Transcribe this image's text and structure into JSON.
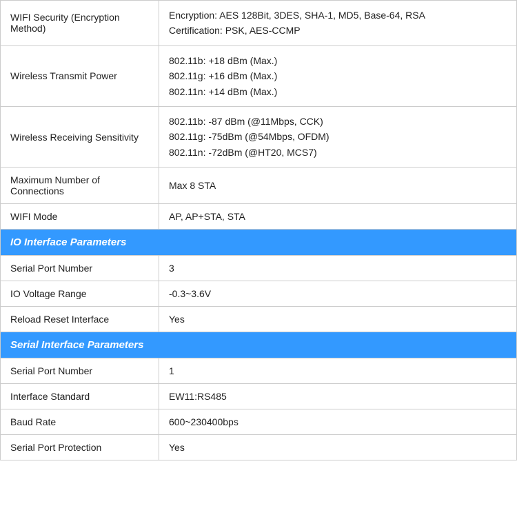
{
  "rows": [
    {
      "type": "data",
      "label": "WIFI Security (Encryption Method)",
      "value": "Encryption: AES 128Bit, 3DES, SHA-1, MD5, Base-64, RSA\nCertification: PSK, AES-CCMP"
    },
    {
      "type": "data",
      "label": "Wireless Transmit Power",
      "value": "802.11b: +18 dBm (Max.)\n802.11g: +16 dBm (Max.)\n802.11n: +14 dBm (Max.)"
    },
    {
      "type": "data",
      "label": "Wireless Receiving Sensitivity",
      "value": "802.11b: -87 dBm (@11Mbps, CCK)\n802.11g: -75dBm (@54Mbps, OFDM)\n802.11n: -72dBm (@HT20, MCS7)"
    },
    {
      "type": "data",
      "label": "Maximum Number of Connections",
      "value": "Max 8 STA"
    },
    {
      "type": "data",
      "label": "WIFI Mode",
      "value": "AP, AP+STA, STA"
    },
    {
      "type": "section",
      "label": "IO Interface Parameters"
    },
    {
      "type": "data",
      "label": "Serial Port Number",
      "value": "3"
    },
    {
      "type": "data",
      "label": "IO Voltage Range",
      "value": "-0.3~3.6V"
    },
    {
      "type": "data",
      "label": "Reload Reset Interface",
      "value": "Yes"
    },
    {
      "type": "section",
      "label": "Serial Interface Parameters"
    },
    {
      "type": "data",
      "label": "Serial Port Number",
      "value": "1"
    },
    {
      "type": "data",
      "label": "Interface Standard",
      "value": "EW11:RS485"
    },
    {
      "type": "data",
      "label": "Baud Rate",
      "value": "600~230400bps"
    },
    {
      "type": "data",
      "label": "Serial Port Protection",
      "value": "Yes"
    }
  ]
}
